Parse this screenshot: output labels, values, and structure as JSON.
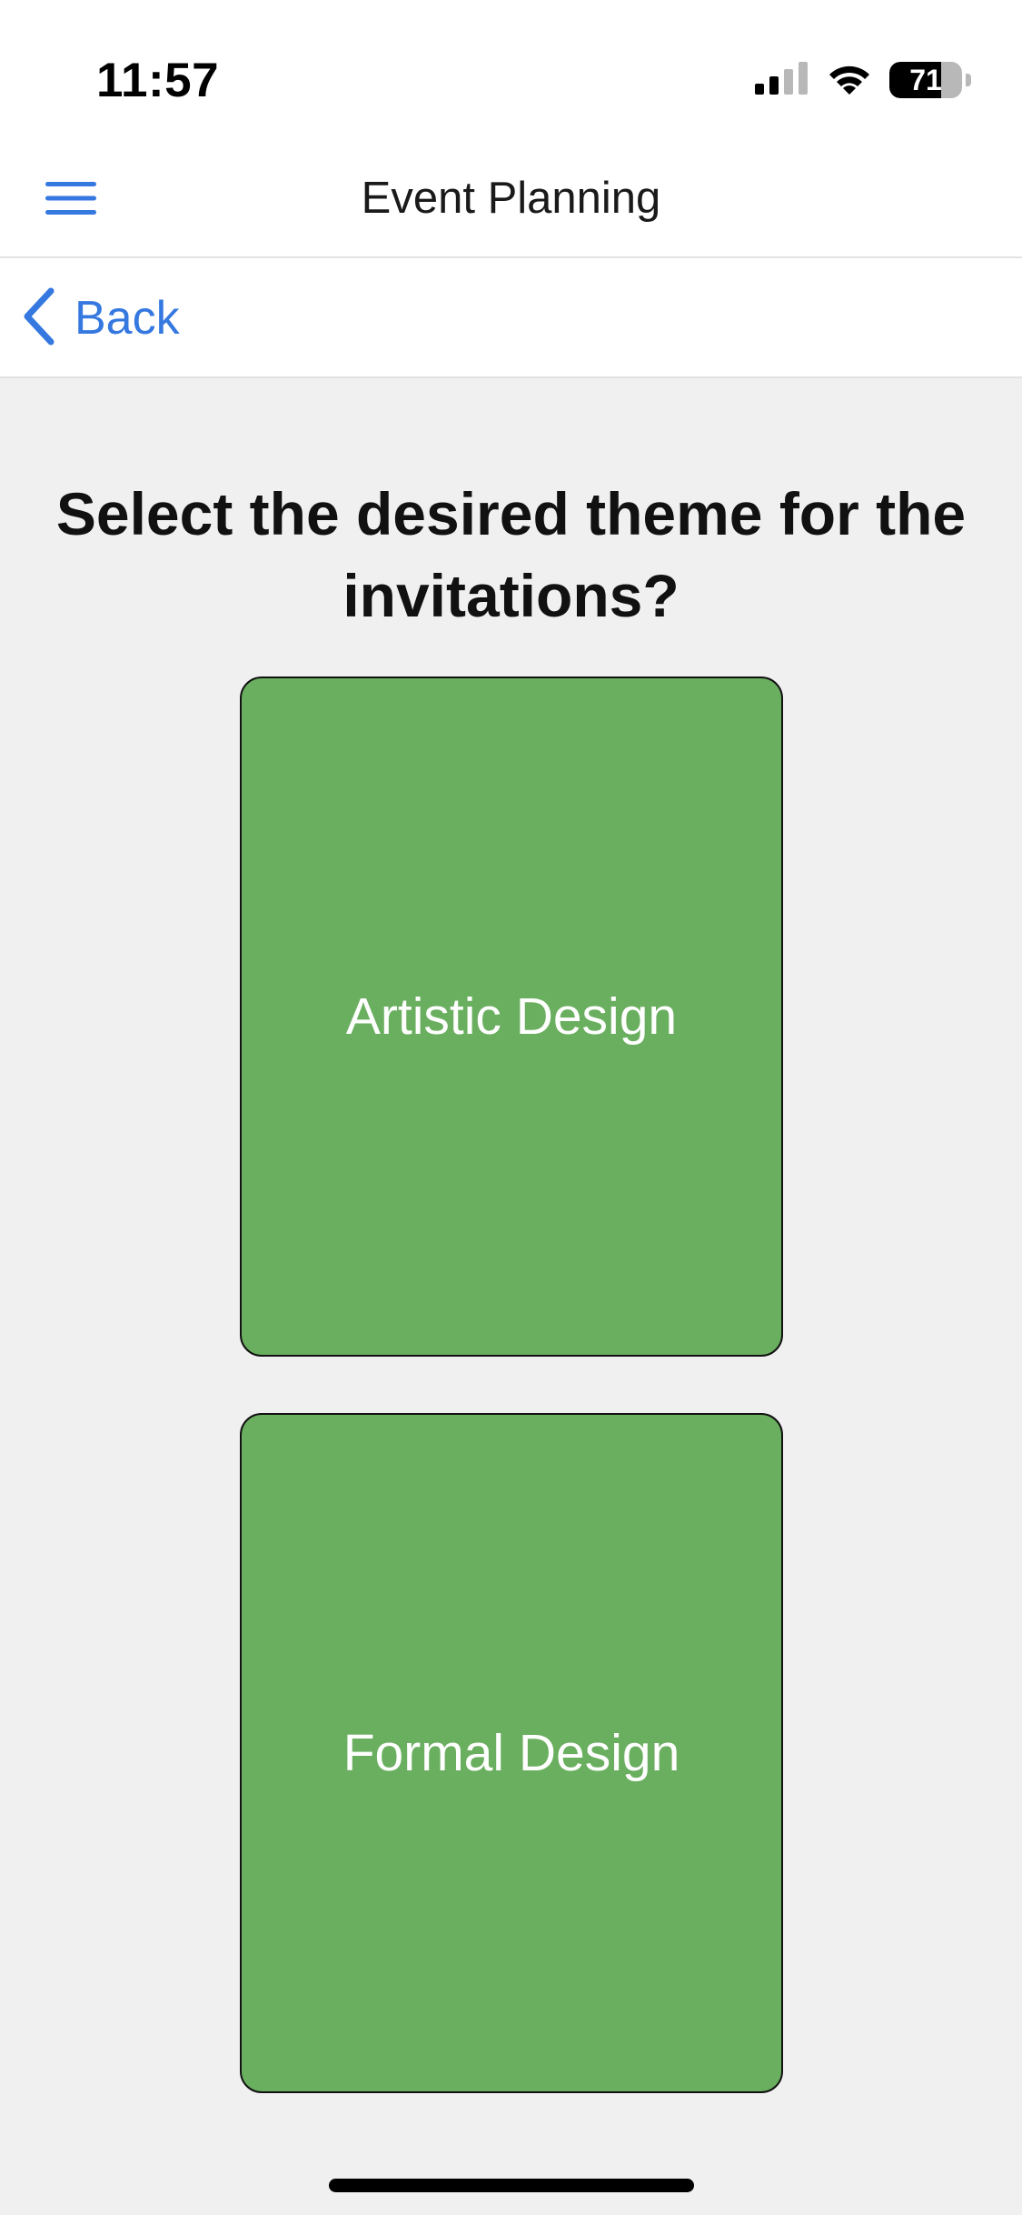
{
  "status_bar": {
    "time": "11:57",
    "battery_level": "71",
    "battery_fraction": 0.71,
    "icons": [
      "signal-icon",
      "wifi-icon",
      "battery-icon"
    ]
  },
  "nav": {
    "title": "Event Planning",
    "menu_icon": "hamburger-menu-icon"
  },
  "back": {
    "label": "Back",
    "icon": "chevron-left-icon"
  },
  "question": "Select the desired theme for the invitations?",
  "options": [
    {
      "label": "Artistic Design"
    },
    {
      "label": "Formal Design"
    }
  ],
  "colors": {
    "accent": "#3478e0",
    "card": "#6aae5f",
    "background": "#f0f0f0"
  }
}
